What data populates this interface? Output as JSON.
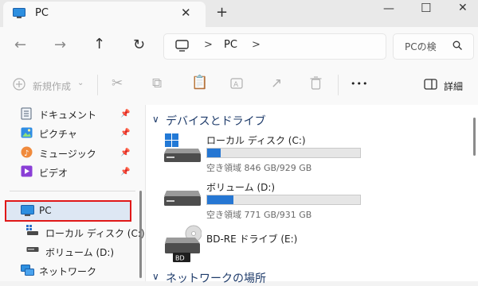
{
  "window": {
    "tab_title": "PC",
    "new_tab_label": "+"
  },
  "address": {
    "crumb_sep1": ">",
    "location": "PC",
    "crumb_sep2": ">",
    "search_placeholder": "PCの検"
  },
  "toolbar": {
    "new_label": "新規作成",
    "more_label": "•••",
    "details_label": "詳細"
  },
  "sidebar": {
    "items": [
      {
        "label": "ドキュメント",
        "pinned": true,
        "icon": "document-icon"
      },
      {
        "label": "ピクチャ",
        "pinned": true,
        "icon": "pictures-icon"
      },
      {
        "label": "ミュージック",
        "pinned": true,
        "icon": "music-icon"
      },
      {
        "label": "ビデオ",
        "pinned": true,
        "icon": "video-icon"
      },
      {
        "label": "PC",
        "selected": true,
        "icon": "pc-icon"
      },
      {
        "label": "ローカル ディスク (C:)",
        "icon": "drive-icon"
      },
      {
        "label": "ボリューム (D:)",
        "icon": "drive-icon"
      },
      {
        "label": "ネットワーク",
        "icon": "network-icon"
      }
    ]
  },
  "main": {
    "section1": "デバイスとドライブ",
    "section2": "ネットワークの場所",
    "drives": [
      {
        "name": "ローカル ディスク (C:)",
        "free": "空き領域 846 GB/929 GB",
        "used_fraction": 0.09
      },
      {
        "name": "ボリューム (D:)",
        "free": "空き領域 771 GB/931 GB",
        "used_fraction": 0.17
      },
      {
        "name": "BD-RE ドライブ (E:)",
        "badge": "BD"
      }
    ]
  },
  "colors": {
    "accent": "#2677d3",
    "highlight_border": "#e01818"
  }
}
